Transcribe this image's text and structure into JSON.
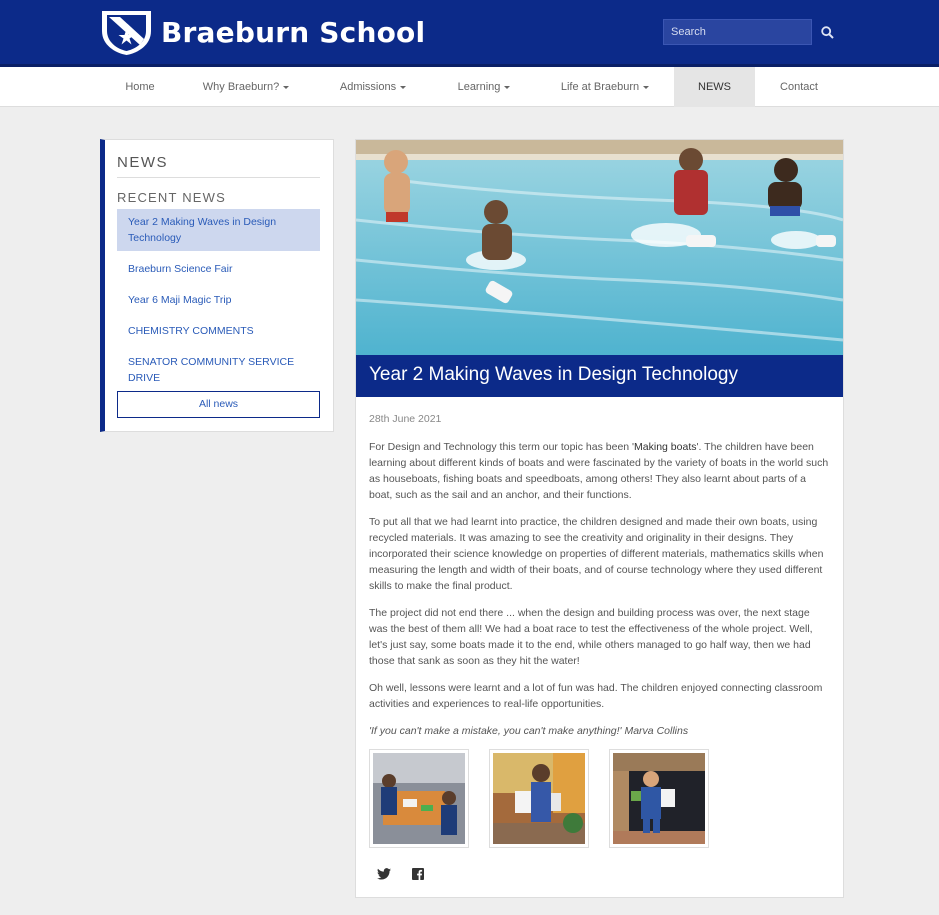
{
  "header": {
    "logo_text": "Braeburn School",
    "search_placeholder": "Search"
  },
  "nav": {
    "items": [
      {
        "label": "Home",
        "dropdown": false
      },
      {
        "label": "Why Braeburn?",
        "dropdown": true
      },
      {
        "label": "Admissions",
        "dropdown": true
      },
      {
        "label": "Learning",
        "dropdown": true
      },
      {
        "label": "Life at Braeburn",
        "dropdown": true
      },
      {
        "label": "NEWS",
        "dropdown": false,
        "active": true
      },
      {
        "label": "Contact",
        "dropdown": false
      }
    ]
  },
  "sidebar": {
    "title": "NEWS",
    "subtitle": "RECENT NEWS",
    "items": [
      {
        "label": "Year 2 Making Waves in Design Technology",
        "selected": true
      },
      {
        "label": "Braeburn Science Fair"
      },
      {
        "label": "Year 6 Maji Magic Trip"
      },
      {
        "label": "CHEMISTRY COMMENTS"
      },
      {
        "label": "SENATOR COMMUNITY SERVICE DRIVE"
      }
    ],
    "all_news_label": "All news"
  },
  "article": {
    "title": "Year 2 Making Waves in Design Technology",
    "date": "28th June 2021",
    "p1_before": "For Design and Technology this term our topic has been '",
    "p1_strong": "Making boats",
    "p1_after": "'. The children have been learning about different kinds of boats and were fascinated by the variety of boats in the world such as houseboats, fishing boats and speedboats, among others! They also learnt about parts of a boat, such as the sail and an anchor, and their functions.",
    "p2": "To put all that we had learnt into practice, the children designed and made their own boats, using recycled materials. It was amazing to see the creativity and originality in their designs. They incorporated their science knowledge on properties of different materials, mathematics skills when measuring the length and width of their boats, and of course technology where they used different skills to make the final product.",
    "p3": "The project did not end there ... when the design and building process was over, the next stage was the best of them all! We had a boat race to test the effectiveness of the whole project. Well, let's just say, some boats made it to the end, while others managed to go half way, then we had those that sank as soon as they hit the water!",
    "p4": "Oh well, lessons were learnt and a lot of fun was had. The children enjoyed connecting classroom activities and experiences to real-life opportunities.",
    "quote": "'If you can't make a mistake, you can't make anything!' Marva Collins"
  },
  "social": {
    "icons": [
      "twitter-icon",
      "facebook-icon"
    ]
  },
  "colors": {
    "brand_navy": "#0c2a89",
    "link_blue": "#2a5bb8",
    "selected_bg": "#cdd7ee"
  }
}
